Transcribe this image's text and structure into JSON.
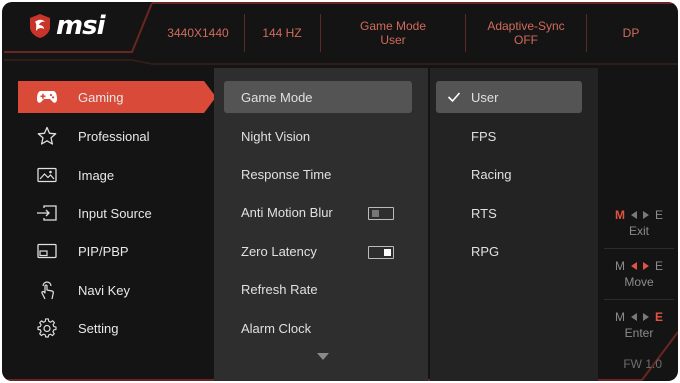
{
  "brand": {
    "name": "msi"
  },
  "info_bar": {
    "resolution": "3440X1440",
    "refresh": "144 HZ",
    "game_mode_label": "Game Mode",
    "game_mode_value": "User",
    "adaptive_sync_label": "Adaptive-Sync",
    "adaptive_sync_value": "OFF",
    "input": "DP"
  },
  "main_menu": [
    {
      "label": "Gaming",
      "icon": "gamepad-icon",
      "active": true
    },
    {
      "label": "Professional",
      "icon": "star-icon",
      "active": false
    },
    {
      "label": "Image",
      "icon": "image-icon",
      "active": false
    },
    {
      "label": "Input Source",
      "icon": "input-source-icon",
      "active": false
    },
    {
      "label": "PIP/PBP",
      "icon": "pip-icon",
      "active": false
    },
    {
      "label": "Navi Key",
      "icon": "navi-key-icon",
      "active": false
    },
    {
      "label": "Setting",
      "icon": "gear-icon",
      "active": false
    }
  ],
  "sub_menu": [
    {
      "label": "Game Mode",
      "active": true
    },
    {
      "label": "Night Vision"
    },
    {
      "label": "Response Time"
    },
    {
      "label": "Anti Motion Blur",
      "toggle": "off"
    },
    {
      "label": "Zero Latency",
      "toggle": "on"
    },
    {
      "label": "Refresh Rate"
    },
    {
      "label": "Alarm Clock"
    }
  ],
  "options": [
    {
      "label": "User",
      "selected": true
    },
    {
      "label": "FPS"
    },
    {
      "label": "Racing"
    },
    {
      "label": "RTS"
    },
    {
      "label": "RPG"
    }
  ],
  "keys": [
    {
      "left": "M",
      "right": "E",
      "label": "Exit",
      "hot": "M"
    },
    {
      "left": "M",
      "right": "E",
      "label": "Move",
      "hot": "arrows"
    },
    {
      "left": "M",
      "right": "E",
      "label": "Enter",
      "hot": "E"
    }
  ],
  "firmware": "FW 1.0",
  "colors": {
    "accent": "#d94a38",
    "frame": "#141414",
    "info_text": "#d06b5c"
  }
}
